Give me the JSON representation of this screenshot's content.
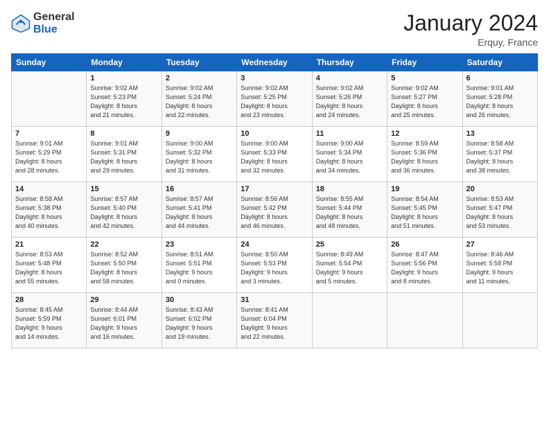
{
  "header": {
    "logo_general": "General",
    "logo_blue": "Blue",
    "month_title": "January 2024",
    "location": "Erquy, France"
  },
  "columns": [
    "Sunday",
    "Monday",
    "Tuesday",
    "Wednesday",
    "Thursday",
    "Friday",
    "Saturday"
  ],
  "weeks": [
    [
      {
        "day": "",
        "info": ""
      },
      {
        "day": "1",
        "info": "Sunrise: 9:02 AM\nSunset: 5:23 PM\nDaylight: 8 hours\nand 21 minutes."
      },
      {
        "day": "2",
        "info": "Sunrise: 9:02 AM\nSunset: 5:24 PM\nDaylight: 8 hours\nand 22 minutes."
      },
      {
        "day": "3",
        "info": "Sunrise: 9:02 AM\nSunset: 5:25 PM\nDaylight: 8 hours\nand 23 minutes."
      },
      {
        "day": "4",
        "info": "Sunrise: 9:02 AM\nSunset: 5:26 PM\nDaylight: 8 hours\nand 24 minutes."
      },
      {
        "day": "5",
        "info": "Sunrise: 9:02 AM\nSunset: 5:27 PM\nDaylight: 8 hours\nand 25 minutes."
      },
      {
        "day": "6",
        "info": "Sunrise: 9:01 AM\nSunset: 5:28 PM\nDaylight: 8 hours\nand 26 minutes."
      }
    ],
    [
      {
        "day": "7",
        "info": "Sunrise: 9:01 AM\nSunset: 5:29 PM\nDaylight: 8 hours\nand 28 minutes."
      },
      {
        "day": "8",
        "info": "Sunrise: 9:01 AM\nSunset: 5:31 PM\nDaylight: 8 hours\nand 29 minutes."
      },
      {
        "day": "9",
        "info": "Sunrise: 9:00 AM\nSunset: 5:32 PM\nDaylight: 8 hours\nand 31 minutes."
      },
      {
        "day": "10",
        "info": "Sunrise: 9:00 AM\nSunset: 5:33 PM\nDaylight: 8 hours\nand 32 minutes."
      },
      {
        "day": "11",
        "info": "Sunrise: 9:00 AM\nSunset: 5:34 PM\nDaylight: 8 hours\nand 34 minutes."
      },
      {
        "day": "12",
        "info": "Sunrise: 8:59 AM\nSunset: 5:36 PM\nDaylight: 8 hours\nand 36 minutes."
      },
      {
        "day": "13",
        "info": "Sunrise: 8:58 AM\nSunset: 5:37 PM\nDaylight: 8 hours\nand 38 minutes."
      }
    ],
    [
      {
        "day": "14",
        "info": "Sunrise: 8:58 AM\nSunset: 5:38 PM\nDaylight: 8 hours\nand 40 minutes."
      },
      {
        "day": "15",
        "info": "Sunrise: 8:57 AM\nSunset: 5:40 PM\nDaylight: 8 hours\nand 42 minutes."
      },
      {
        "day": "16",
        "info": "Sunrise: 8:57 AM\nSunset: 5:41 PM\nDaylight: 8 hours\nand 44 minutes."
      },
      {
        "day": "17",
        "info": "Sunrise: 8:56 AM\nSunset: 5:42 PM\nDaylight: 8 hours\nand 46 minutes."
      },
      {
        "day": "18",
        "info": "Sunrise: 8:55 AM\nSunset: 5:44 PM\nDaylight: 8 hours\nand 48 minutes."
      },
      {
        "day": "19",
        "info": "Sunrise: 8:54 AM\nSunset: 5:45 PM\nDaylight: 8 hours\nand 51 minutes."
      },
      {
        "day": "20",
        "info": "Sunrise: 8:53 AM\nSunset: 5:47 PM\nDaylight: 8 hours\nand 53 minutes."
      }
    ],
    [
      {
        "day": "21",
        "info": "Sunrise: 8:53 AM\nSunset: 5:48 PM\nDaylight: 8 hours\nand 55 minutes."
      },
      {
        "day": "22",
        "info": "Sunrise: 8:52 AM\nSunset: 5:50 PM\nDaylight: 8 hours\nand 58 minutes."
      },
      {
        "day": "23",
        "info": "Sunrise: 8:51 AM\nSunset: 5:51 PM\nDaylight: 9 hours\nand 0 minutes."
      },
      {
        "day": "24",
        "info": "Sunrise: 8:50 AM\nSunset: 5:53 PM\nDaylight: 9 hours\nand 3 minutes."
      },
      {
        "day": "25",
        "info": "Sunrise: 8:49 AM\nSunset: 5:54 PM\nDaylight: 9 hours\nand 5 minutes."
      },
      {
        "day": "26",
        "info": "Sunrise: 8:47 AM\nSunset: 5:56 PM\nDaylight: 9 hours\nand 8 minutes."
      },
      {
        "day": "27",
        "info": "Sunrise: 8:46 AM\nSunset: 5:58 PM\nDaylight: 9 hours\nand 11 minutes."
      }
    ],
    [
      {
        "day": "28",
        "info": "Sunrise: 8:45 AM\nSunset: 5:59 PM\nDaylight: 9 hours\nand 14 minutes."
      },
      {
        "day": "29",
        "info": "Sunrise: 8:44 AM\nSunset: 6:01 PM\nDaylight: 9 hours\nand 16 minutes."
      },
      {
        "day": "30",
        "info": "Sunrise: 8:43 AM\nSunset: 6:02 PM\nDaylight: 9 hours\nand 19 minutes."
      },
      {
        "day": "31",
        "info": "Sunrise: 8:41 AM\nSunset: 6:04 PM\nDaylight: 9 hours\nand 22 minutes."
      },
      {
        "day": "",
        "info": ""
      },
      {
        "day": "",
        "info": ""
      },
      {
        "day": "",
        "info": ""
      }
    ]
  ]
}
